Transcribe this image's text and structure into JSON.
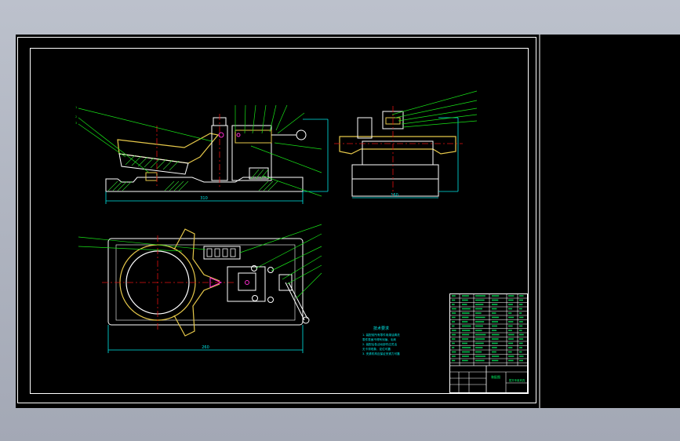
{
  "window": {
    "background_colors": [
      "#bcc1cc",
      "#a3a8b5"
    ],
    "canvas_color": "#000000"
  },
  "palette": {
    "frame": "#ffffff",
    "part_outline": "#ffffff",
    "part_fill_yellow": "#e6c84a",
    "leader": "#18e218",
    "center_line": "#e01010",
    "dimension": "#00e6e6",
    "highlight": "#ff2bd0",
    "hatch": "#30d230",
    "text_note": "#00e6e6",
    "title_block_text": "#00ff66"
  },
  "drawing": {
    "views": [
      "front-view",
      "side-view",
      "top-view"
    ],
    "tech_note": {
      "title": "技术要求",
      "lines": [
        "1. 装配前所有零件用煤油清洗",
        "   零件表面不得有划痕、毛刺",
        "2. 装配后各活动部件应灵活",
        "   无卡滞现象，定位可靠",
        "3. 夹紧机构应保证夹紧力可靠"
      ]
    },
    "title_block": {
      "name_label": "装配图",
      "project_label": "拨叉专用夹具"
    },
    "dimension_labels": {
      "front_width": "310",
      "side_width": "160",
      "top_width": "260"
    }
  }
}
